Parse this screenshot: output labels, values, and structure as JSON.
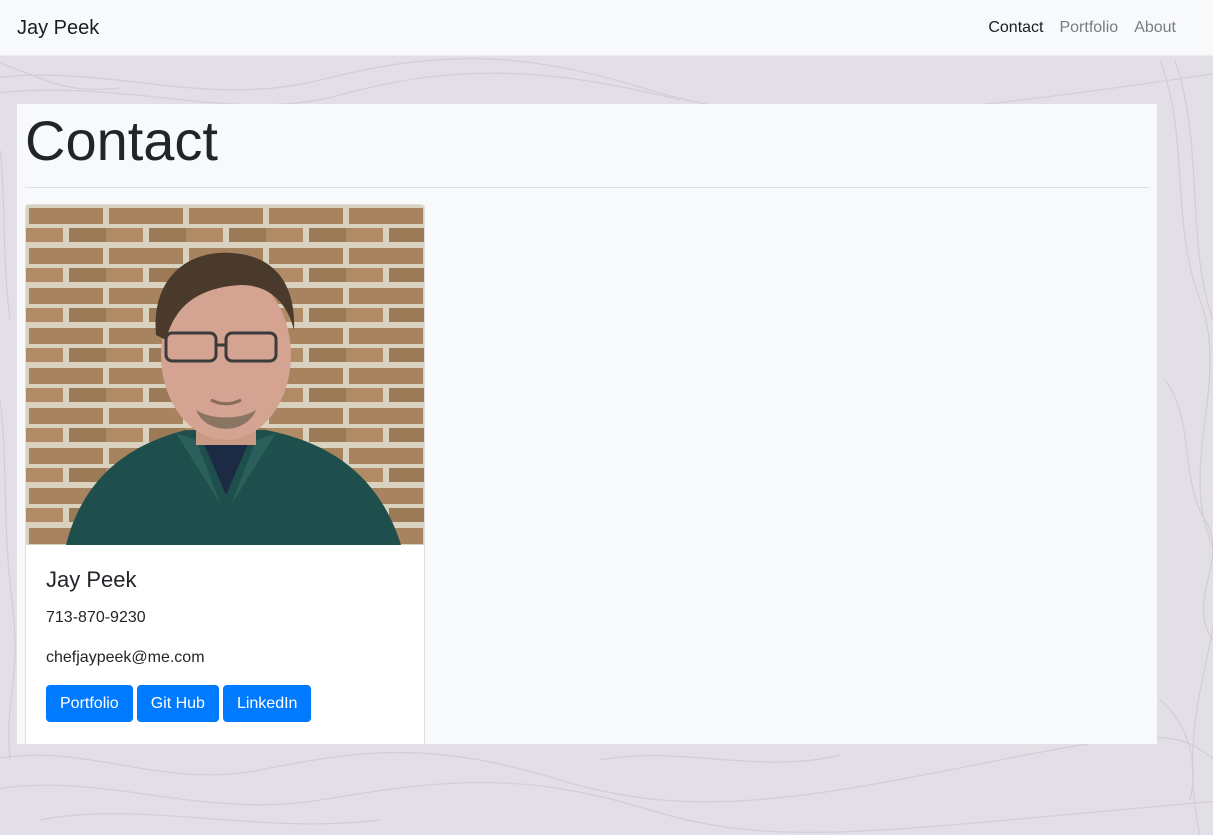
{
  "navbar": {
    "brand": "Jay Peek",
    "links": [
      {
        "label": "Contact",
        "active": true
      },
      {
        "label": "Portfolio",
        "active": false
      },
      {
        "label": "About",
        "active": false
      }
    ]
  },
  "page": {
    "title": "Contact"
  },
  "card": {
    "name": "Jay Peek",
    "phone": "713-870-9230",
    "email": "chefjaypeek@me.com",
    "buttons": [
      "Portfolio",
      "Git Hub",
      "LinkedIn"
    ]
  },
  "colors": {
    "primary": "#007bff",
    "navbar_bg": "#f8f9fa",
    "page_bg": "#e3dfe6",
    "panel_bg": "#f8f9fa"
  }
}
